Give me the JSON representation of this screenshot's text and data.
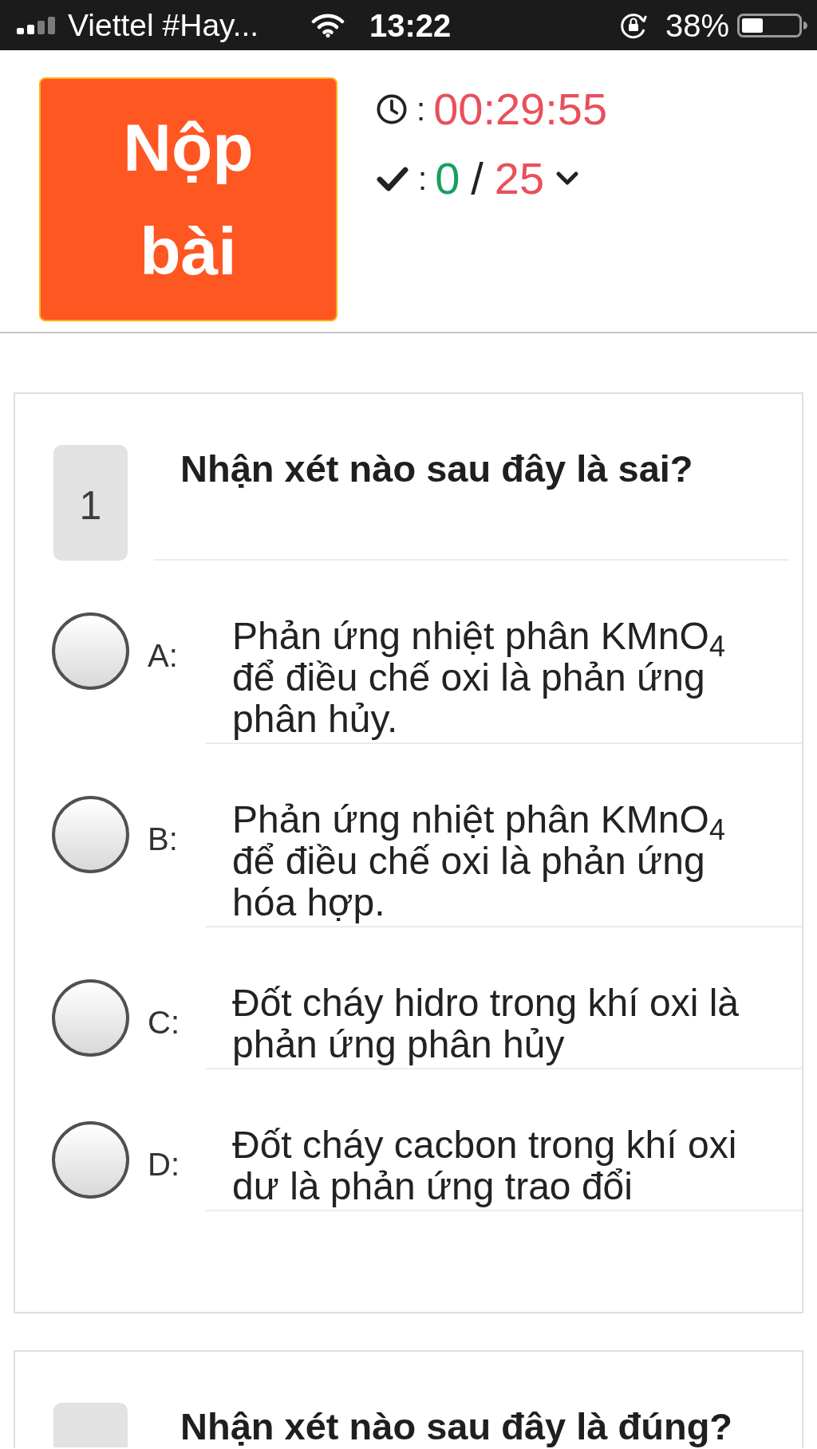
{
  "status_bar": {
    "carrier": "Viettel #Hay...",
    "time": "13:22",
    "battery_percent": "38%"
  },
  "header": {
    "submit_button": "Nộp bài",
    "timer": {
      "separator": ":",
      "value": "00:29:55"
    },
    "score": {
      "separator": ":",
      "correct": "0",
      "slash": "/",
      "total": "25"
    }
  },
  "questions": [
    {
      "number": "1",
      "text": "Nhận xét nào sau đây là sai?",
      "options": [
        {
          "label": "A:",
          "text": "Phản ứng nhiệt phân KMnO$_{4}$ để điều chế oxi là phản ứng phân hủy.",
          "selected": false
        },
        {
          "label": "B:",
          "text": "Phản ứng nhiệt phân KMnO$_{4}$ để điều chế oxi là phản ứng hóa hợp.",
          "selected": false
        },
        {
          "label": "C:",
          "text": "Đốt cháy hidro trong khí oxi là phản ứng phân hủy",
          "selected": false
        },
        {
          "label": "D:",
          "text": "Đốt cháy cacbon trong khí oxi dư là phản ứng trao đổi",
          "selected": false
        }
      ]
    },
    {
      "text": "Nhận xét nào sau đây là đúng?"
    }
  ]
}
